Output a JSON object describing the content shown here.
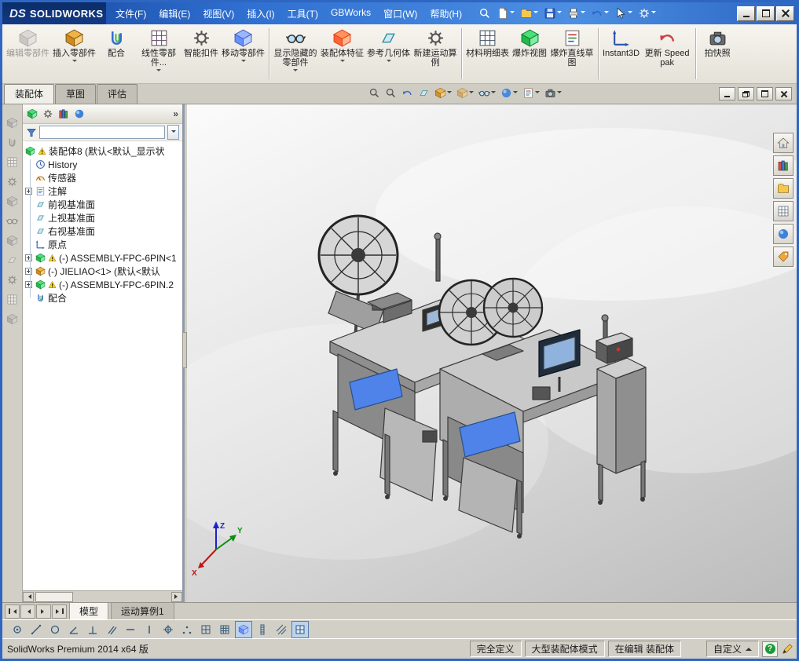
{
  "title_bar": {
    "logo_mark": "DS",
    "logo_text": "SOLIDWORKS",
    "menus": [
      "文件(F)",
      "编辑(E)",
      "视图(V)",
      "插入(I)",
      "工具(T)",
      "GBWorks",
      "窗口(W)",
      "帮助(H)"
    ],
    "quick_icon_names": [
      "search-icon",
      "new-document-icon",
      "open-document-icon",
      "save-icon",
      "print-icon",
      "undo-icon",
      "select-arrow-icon",
      "options-gear-icon"
    ],
    "window_button_names": [
      "minimize-button",
      "maximize-button",
      "close-button"
    ]
  },
  "ribbon": {
    "tabs": [
      {
        "label": "装配体",
        "active": true
      },
      {
        "label": "草图",
        "active": false
      },
      {
        "label": "评估",
        "active": false
      }
    ],
    "buttons": [
      {
        "label": "编辑零部件",
        "icon": "edit-component-icon",
        "disabled": true,
        "dropdown": false
      },
      {
        "label": "插入零部件",
        "icon": "insert-component-icon",
        "disabled": false,
        "dropdown": true
      },
      {
        "label": "配合",
        "icon": "mate-icon",
        "disabled": false,
        "dropdown": false
      },
      {
        "label": "线性零部件...",
        "icon": "linear-component-pattern-icon",
        "disabled": false,
        "dropdown": true
      },
      {
        "label": "智能扣件",
        "icon": "smart-fasteners-icon",
        "disabled": false,
        "dropdown": false
      },
      {
        "label": "移动零部件",
        "icon": "move-component-icon",
        "disabled": false,
        "dropdown": true
      },
      {
        "label": "显示隐藏的零部件",
        "icon": "show-hidden-components-icon",
        "disabled": false,
        "dropdown": true
      },
      {
        "label": "装配体特征",
        "icon": "assembly-features-icon",
        "disabled": false,
        "dropdown": true
      },
      {
        "label": "参考几何体",
        "icon": "reference-geometry-icon",
        "disabled": false,
        "dropdown": true
      },
      {
        "label": "新建运动算例",
        "icon": "new-motion-study-icon",
        "disabled": false,
        "dropdown": false
      },
      {
        "label": "材料明细表",
        "icon": "bill-of-materials-icon",
        "disabled": false,
        "dropdown": false
      },
      {
        "label": "爆炸视图",
        "icon": "exploded-view-icon",
        "disabled": false,
        "dropdown": false
      },
      {
        "label": "爆炸直线草图",
        "icon": "explode-line-sketch-icon",
        "disabled": false,
        "dropdown": false
      },
      {
        "label": "Instant3D",
        "icon": "instant3d-icon",
        "disabled": false,
        "dropdown": false
      },
      {
        "label": "更新 Speedpak",
        "icon": "update-speedpak-icon",
        "disabled": false,
        "dropdown": false
      },
      {
        "label": "拍快照",
        "icon": "snapshot-icon",
        "disabled": false,
        "dropdown": false
      }
    ]
  },
  "feature_panel": {
    "header_icon_names": [
      "featuremanager-tree-icon",
      "propertymanager-icon",
      "configurationmanager-icon",
      "displaymanager-icon"
    ],
    "overflow_chevron": "»",
    "filter": {
      "value": "",
      "placeholder": ""
    },
    "tree": [
      {
        "label": "装配体8 (默认<默认_显示状",
        "icon": "assembly-icon",
        "warning": true,
        "expandable": false
      },
      {
        "label": "History",
        "icon": "history-icon",
        "warning": false,
        "expandable": false
      },
      {
        "label": "传感器",
        "icon": "sensors-icon",
        "warning": false,
        "expandable": false
      },
      {
        "label": "注解",
        "icon": "annotations-icon",
        "warning": false,
        "expandable": true
      },
      {
        "label": "前视基准面",
        "icon": "plane-icon",
        "warning": false,
        "expandable": false
      },
      {
        "label": "上视基准面",
        "icon": "plane-icon",
        "warning": false,
        "expandable": false
      },
      {
        "label": "右视基准面",
        "icon": "plane-icon",
        "warning": false,
        "expandable": false
      },
      {
        "label": "原点",
        "icon": "origin-icon",
        "warning": false,
        "expandable": false
      },
      {
        "label": "(-) ASSEMBLY-FPC-6PIN<1",
        "icon": "subassembly-icon",
        "warning": true,
        "expandable": true
      },
      {
        "label": "(-) JIELIAO<1> (默认<默认",
        "icon": "subassembly-icon",
        "warning": false,
        "expandable": true
      },
      {
        "label": "(-) ASSEMBLY-FPC-6PIN.2",
        "icon": "subassembly-icon",
        "warning": true,
        "expandable": true
      },
      {
        "label": "配合",
        "icon": "mates-icon",
        "warning": false,
        "expandable": false
      }
    ]
  },
  "viewport": {
    "hud_icon_names": [
      "zoom-fit-icon",
      "zoom-area-icon",
      "previous-view-icon",
      "section-view-icon",
      "view-orientation-icon",
      "display-style-icon",
      "hide-show-items-icon",
      "edit-appearance-icon",
      "apply-scene-icon",
      "view-settings-icon"
    ],
    "doc_window_icon_names": [
      "doc-minimize-icon",
      "doc-restore-icon",
      "doc-maximize-icon",
      "doc-close-icon"
    ],
    "triad": {
      "x": "X",
      "y": "Y",
      "z": "Z"
    }
  },
  "task_pane": {
    "icon_names": [
      "solidworks-resources-icon",
      "design-library-icon",
      "file-explorer-icon",
      "view-palette-icon",
      "appearances-scenes-icon",
      "custom-properties-icon"
    ]
  },
  "model_tabs": {
    "items": [
      {
        "label": "模型",
        "active": true
      },
      {
        "label": "运动算例1",
        "active": false
      }
    ]
  },
  "snap_toolbar": {
    "icon_names": [
      "snap-point-icon",
      "snap-line-icon",
      "snap-circle-icon",
      "snap-angle-icon",
      "snap-perpendicular-icon",
      "snap-parallel-icon",
      "snap-horizontal-icon",
      "snap-vertical-icon",
      "snap-center-icon",
      "snap-nearest-icon",
      "snap-grid-icon",
      "snap-grid-dense-icon",
      "snap-solid-icon",
      "snap-length-icon",
      "snap-hatch-icon",
      "snap-grid-toggle-icon"
    ]
  },
  "dock_toolbar": {
    "icon_names": [
      "insert-components-icon",
      "mate-icon",
      "linear-component-pattern-icon",
      "smart-fasteners-icon",
      "move-component-icon",
      "show-hidden-components-icon",
      "assembly-features-icon",
      "reference-geometry-icon",
      "new-motion-study-icon",
      "bill-of-materials-icon",
      "exploded-view-icon"
    ]
  },
  "status_bar": {
    "product": "SolidWorks Premium 2014 x64 版",
    "define_state": "完全定义",
    "assembly_mode": "大型装配体模式",
    "editing": "在编辑 装配体",
    "custom": "自定义",
    "help_glyph": "?"
  }
}
